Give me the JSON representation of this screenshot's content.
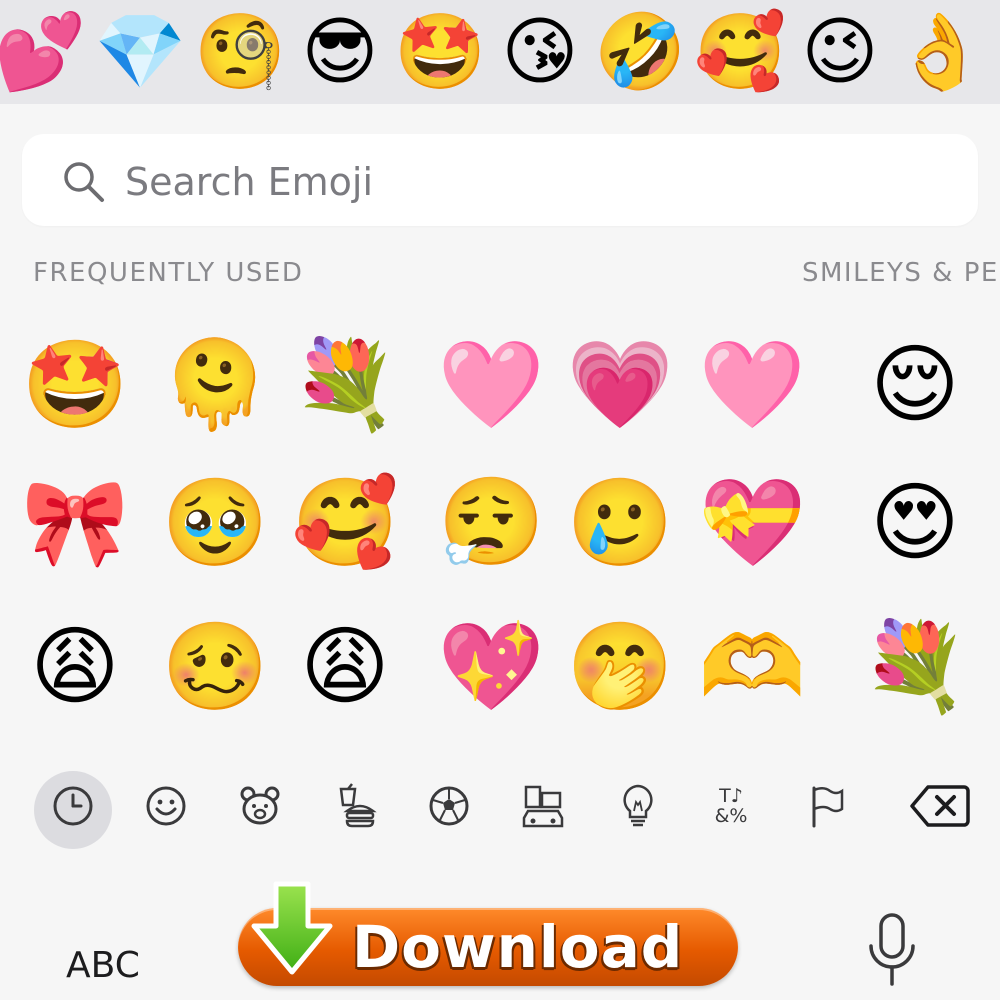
{
  "top_bar": {
    "emojis": [
      {
        "char": "💕",
        "name": "two-hearts-emoji"
      },
      {
        "char": "💎",
        "name": "gem-emoji"
      },
      {
        "char": "🧐",
        "name": "monocle-face-emoji"
      },
      {
        "char": "😎",
        "name": "sunglasses-face-emoji"
      },
      {
        "char": "🤩",
        "name": "star-struck-emoji"
      },
      {
        "char": "😘",
        "name": "blowing-kiss-emoji"
      },
      {
        "char": "🤣",
        "name": "rolling-laughing-emoji"
      },
      {
        "char": "🥰",
        "name": "smiling-hearts-emoji"
      },
      {
        "char": "😉",
        "name": "winking-face-emoji"
      },
      {
        "char": "👌",
        "name": "ok-hand-emoji"
      }
    ]
  },
  "search": {
    "placeholder": "Search Emoji"
  },
  "sections": {
    "frequently_used": "FREQUENTLY USED",
    "smileys": "SMILEYS & PE"
  },
  "grid": {
    "rows": [
      [
        "🤩",
        "🫠",
        "💐",
        "🩷",
        "💗",
        "🩷",
        "😌"
      ],
      [
        "🎀",
        "🥹",
        "🥰",
        "😮‍💨",
        "🥲",
        "💝",
        "😍"
      ],
      [
        "😩",
        "🥴",
        "😩",
        "💖",
        "🤭",
        "🫶",
        "💐"
      ]
    ]
  },
  "categories": [
    {
      "name": "recent-clock-icon",
      "active": true
    },
    {
      "name": "smileys-icon",
      "active": false
    },
    {
      "name": "animals-bear-icon",
      "active": false
    },
    {
      "name": "food-drink-icon",
      "active": false
    },
    {
      "name": "activity-soccer-icon",
      "active": false
    },
    {
      "name": "travel-places-icon",
      "active": false
    },
    {
      "name": "objects-lightbulb-icon",
      "active": false
    },
    {
      "name": "symbols-icon",
      "active": false
    },
    {
      "name": "flags-icon",
      "active": false
    },
    {
      "name": "backspace-icon",
      "active": false
    }
  ],
  "symbols_glyph_top": "T♪",
  "symbols_glyph_bottom": "&%",
  "keyboard": {
    "abc_label": "ABC",
    "download_label": "Download"
  },
  "colors": {
    "download_orange": "#e55a00",
    "download_arrow_green": "#6ccf2e",
    "icon_gray": "#3a3a3c"
  }
}
